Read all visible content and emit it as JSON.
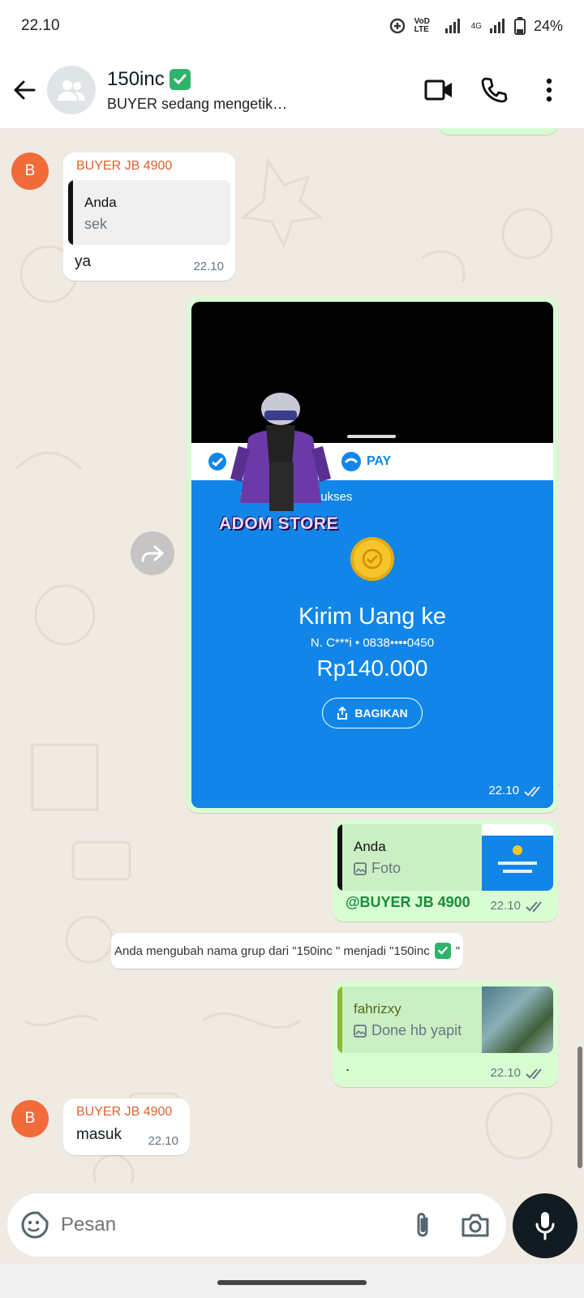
{
  "status_bar": {
    "time": "22.10",
    "network": "4G",
    "volte": "VoD LTE",
    "battery": "24%"
  },
  "header": {
    "title": "150inc",
    "subtitle": "BUYER sedang mengetik…"
  },
  "messages": {
    "m1": {
      "avatar": "B",
      "sender": "BUYER JB 4900",
      "quote_name": "Anda",
      "quote_text": "sek",
      "text": "ya",
      "time": "22.10"
    },
    "m2": {
      "time": "22.10",
      "image": {
        "top_label": "PAY",
        "status": "Pembayaran Sukses",
        "heading": "Kirim Uang ke",
        "recipient": "N. C***i • 0838••••0450",
        "amount": "Rp140.000",
        "share_label": "BAGIKAN",
        "watermark": "ADOM STORE"
      }
    },
    "m3": {
      "quote_name": "Anda",
      "quote_text": "Foto",
      "mention": "@BUYER JB 4900",
      "time": "22.10"
    },
    "system": {
      "text": "Anda mengubah nama grup dari \"150inc \" menjadi \"150inc"
    },
    "m4": {
      "quote_name": "fahrizxy",
      "quote_text": "Done hb yapit",
      "text": ".",
      "time": "22.10"
    },
    "m5": {
      "avatar": "B",
      "sender": "BUYER JB 4900",
      "text": "masuk",
      "time": "22.10"
    }
  },
  "composer": {
    "placeholder": "Pesan"
  },
  "colors": {
    "accent_green": "#d9fdd3",
    "sender_orange": "#e3602d",
    "pay_blue": "#1186e8",
    "check_green": "#2fb36a"
  }
}
